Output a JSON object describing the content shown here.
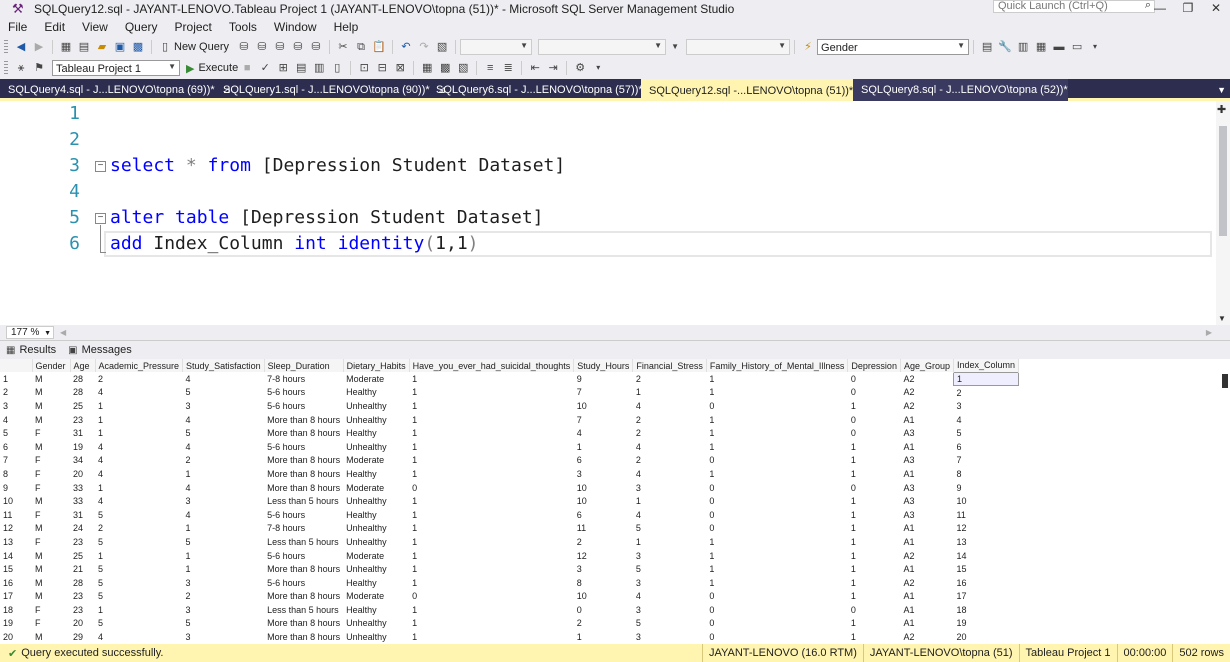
{
  "window": {
    "title": "SQLQuery12.sql - JAYANT-LENOVO.Tableau Project 1 (JAYANT-LENOVO\\topna (51))* - Microsoft SQL Server Management Studio",
    "quick_launch_placeholder": "Quick Launch (Ctrl+Q)"
  },
  "menu": [
    "File",
    "Edit",
    "View",
    "Query",
    "Project",
    "Tools",
    "Window",
    "Help"
  ],
  "toolbar": {
    "new_query": "New Query",
    "gender_combo": "Gender",
    "database_combo": "Tableau Project 1",
    "execute": "Execute"
  },
  "tabs": [
    {
      "label": "SQLQuery4.sql - J...LENOVO\\topna (69))*",
      "active": false
    },
    {
      "label": "SQLQuery1.sql - J...LENOVO\\topna (90))*",
      "active": false
    },
    {
      "label": "SQLQuery6.sql - J...LENOVO\\topna (57))*",
      "active": false
    },
    {
      "label": "SQLQuery12.sql -...LENOVO\\topna (51))*",
      "active": true
    },
    {
      "label": "SQLQuery8.sql - J...LENOVO\\topna (52))*",
      "active": false
    }
  ],
  "editor": {
    "line_numbers": [
      "1",
      "2",
      "3",
      "4",
      "5",
      "6"
    ],
    "line3": {
      "kw1": "select",
      "star": "*",
      "kw2": "from",
      "rest": "[Depression Student Dataset]"
    },
    "line5": {
      "kw1": "alter table",
      "rest": "[Depression Student Dataset]"
    },
    "line6": {
      "kw1": "add",
      "col": "Index_Column",
      "kw2": "int",
      "fn": "identity",
      "open": "(",
      "args": "1,1",
      "close": ")"
    }
  },
  "zoom": "177 %",
  "results_tabs": {
    "results": "Results",
    "messages": "Messages"
  },
  "grid": {
    "columns": [
      "Gender",
      "Age",
      "Academic_Pressure",
      "Study_Satisfaction",
      "Sleep_Duration",
      "Dietary_Habits",
      "Have_you_ever_had_suicidal_thoughts",
      "Study_Hours",
      "Financial_Stress",
      "Family_History_of_Mental_Illness",
      "Depression",
      "Age_Group",
      "Index_Column"
    ],
    "rows": [
      [
        "1",
        "M",
        "28",
        "2",
        "4",
        "7-8 hours",
        "Moderate",
        "1",
        "9",
        "2",
        "1",
        "0",
        "A2",
        "1"
      ],
      [
        "2",
        "M",
        "28",
        "4",
        "5",
        "5-6 hours",
        "Healthy",
        "1",
        "7",
        "1",
        "1",
        "0",
        "A2",
        "2"
      ],
      [
        "3",
        "M",
        "25",
        "1",
        "3",
        "5-6 hours",
        "Unhealthy",
        "1",
        "10",
        "4",
        "0",
        "1",
        "A2",
        "3"
      ],
      [
        "4",
        "M",
        "23",
        "1",
        "4",
        "More than 8 hours",
        "Unhealthy",
        "1",
        "7",
        "2",
        "1",
        "0",
        "A1",
        "4"
      ],
      [
        "5",
        "F",
        "31",
        "1",
        "5",
        "More than 8 hours",
        "Healthy",
        "1",
        "4",
        "2",
        "1",
        "0",
        "A3",
        "5"
      ],
      [
        "6",
        "M",
        "19",
        "4",
        "4",
        "5-6 hours",
        "Unhealthy",
        "1",
        "1",
        "4",
        "1",
        "1",
        "A1",
        "6"
      ],
      [
        "7",
        "F",
        "34",
        "4",
        "2",
        "More than 8 hours",
        "Moderate",
        "1",
        "6",
        "2",
        "0",
        "1",
        "A3",
        "7"
      ],
      [
        "8",
        "F",
        "20",
        "4",
        "1",
        "More than 8 hours",
        "Healthy",
        "1",
        "3",
        "4",
        "1",
        "1",
        "A1",
        "8"
      ],
      [
        "9",
        "F",
        "33",
        "1",
        "4",
        "More than 8 hours",
        "Moderate",
        "0",
        "10",
        "3",
        "0",
        "0",
        "A3",
        "9"
      ],
      [
        "10",
        "M",
        "33",
        "4",
        "3",
        "Less than 5 hours",
        "Unhealthy",
        "1",
        "10",
        "1",
        "0",
        "1",
        "A3",
        "10"
      ],
      [
        "11",
        "F",
        "31",
        "5",
        "4",
        "5-6 hours",
        "Healthy",
        "1",
        "6",
        "4",
        "0",
        "1",
        "A3",
        "11"
      ],
      [
        "12",
        "M",
        "24",
        "2",
        "1",
        "7-8 hours",
        "Unhealthy",
        "1",
        "11",
        "5",
        "0",
        "1",
        "A1",
        "12"
      ],
      [
        "13",
        "F",
        "23",
        "5",
        "5",
        "Less than 5 hours",
        "Unhealthy",
        "1",
        "2",
        "1",
        "1",
        "1",
        "A1",
        "13"
      ],
      [
        "14",
        "M",
        "25",
        "1",
        "1",
        "5-6 hours",
        "Moderate",
        "1",
        "12",
        "3",
        "1",
        "1",
        "A2",
        "14"
      ],
      [
        "15",
        "M",
        "21",
        "5",
        "1",
        "More than 8 hours",
        "Unhealthy",
        "1",
        "3",
        "5",
        "1",
        "1",
        "A1",
        "15"
      ],
      [
        "16",
        "M",
        "28",
        "5",
        "3",
        "5-6 hours",
        "Healthy",
        "1",
        "8",
        "3",
        "1",
        "1",
        "A2",
        "16"
      ],
      [
        "17",
        "M",
        "23",
        "5",
        "2",
        "More than 8 hours",
        "Moderate",
        "0",
        "10",
        "4",
        "0",
        "1",
        "A1",
        "17"
      ],
      [
        "18",
        "F",
        "23",
        "1",
        "3",
        "Less than 5 hours",
        "Healthy",
        "1",
        "0",
        "3",
        "0",
        "0",
        "A1",
        "18"
      ],
      [
        "19",
        "F",
        "20",
        "5",
        "5",
        "More than 8 hours",
        "Unhealthy",
        "1",
        "2",
        "5",
        "0",
        "1",
        "A1",
        "19"
      ],
      [
        "20",
        "M",
        "29",
        "4",
        "3",
        "More than 8 hours",
        "Unhealthy",
        "1",
        "1",
        "3",
        "0",
        "1",
        "A2",
        "20"
      ]
    ]
  },
  "status": {
    "message": "Query executed successfully.",
    "server": "JAYANT-LENOVO (16.0 RTM)",
    "user": "JAYANT-LENOVO\\topna (51)",
    "database": "Tableau Project 1",
    "time": "00:00:00",
    "rows": "502 rows"
  }
}
